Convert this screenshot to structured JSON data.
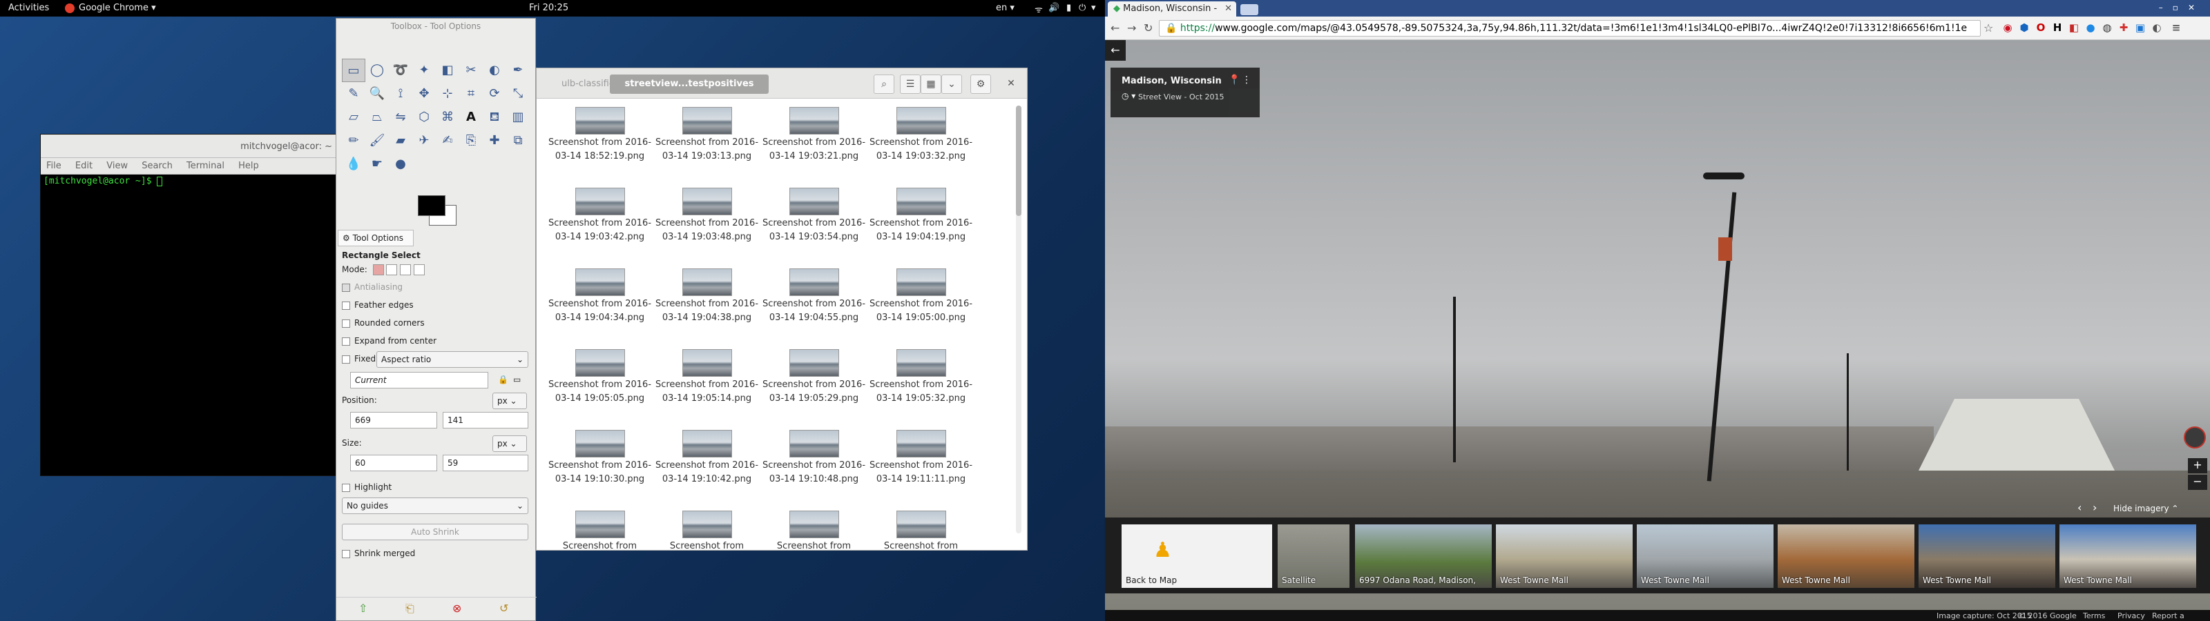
{
  "topbar": {
    "activities": "Activities",
    "app": "Google Chrome ▾",
    "clock": "Fri 20:25",
    "lang": "en ▾"
  },
  "terminal": {
    "title": "mitchvogel@acor: ~",
    "menu": [
      "File",
      "Edit",
      "View",
      "Search",
      "Terminal",
      "Help"
    ],
    "prompt": "[mitchvogel@acor ~]$ "
  },
  "file_manager": {
    "tab_inactive": "ulb-classifier",
    "tab_active": "streetview...testpositives",
    "files": [
      "Screenshot from 2016-03-14 18:52:19.png",
      "Screenshot from 2016-03-14 19:03:13.png",
      "Screenshot from 2016-03-14 19:03:21.png",
      "Screenshot from 2016-03-14 19:03:32.png",
      "Screenshot from 2016-03-14 19:03:42.png",
      "Screenshot from 2016-03-14 19:03:48.png",
      "Screenshot from 2016-03-14 19:03:54.png",
      "Screenshot from 2016-03-14 19:04:19.png",
      "Screenshot from 2016-03-14 19:04:34.png",
      "Screenshot from 2016-03-14 19:04:38.png",
      "Screenshot from 2016-03-14 19:04:55.png",
      "Screenshot from 2016-03-14 19:05:00.png",
      "Screenshot from 2016-03-14 19:05:05.png",
      "Screenshot from 2016-03-14 19:05:14.png",
      "Screenshot from 2016-03-14 19:05:29.png",
      "Screenshot from 2016-03-14 19:05:32.png",
      "Screenshot from 2016-03-14 19:10:30.png",
      "Screenshot from 2016-03-14 19:10:42.png",
      "Screenshot from 2016-03-14 19:10:48.png",
      "Screenshot from 2016-03-14 19:11:11.png",
      "Screenshot from",
      "Screenshot from",
      "Screenshot from",
      "Screenshot from"
    ]
  },
  "gimp": {
    "title": "Toolbox - Tool Options",
    "tool_options_tab": "Tool Options",
    "tool_name": "Rectangle Select",
    "mode_label": "Mode:",
    "antialiasing": "Antialiasing",
    "feather": "Feather edges",
    "rounded": "Rounded corners",
    "expand": "Expand from center",
    "fixed": "Fixed:",
    "fixed_value": "Aspect ratio",
    "current": "Current",
    "position_label": "Position:",
    "pos_x": "669",
    "pos_y": "141",
    "unit": "px",
    "size_label": "Size:",
    "size_w": "60",
    "size_h": "59",
    "highlight": "Highlight",
    "guides": "No guides",
    "auto_shrink": "Auto Shrink",
    "shrink_merged": "Shrink merged"
  },
  "chrome": {
    "tab_title": "Madison, Wisconsin - ",
    "url_https": "https://",
    "url_rest": "www.google.com/maps/@43.0549578,-89.5075324,3a,75y,94.86h,111.32t/data=!3m6!1e1!3m4!1sl34LQ0-ePlBI7o...4iwrZ4Q!2e0!7i13312!8i6656!6m1!1e",
    "ext_h": "H"
  },
  "streetview": {
    "place": "Madison, Wisconsin",
    "date": "Street View - Oct 2015",
    "hide_imagery": "Hide imagery",
    "back_to_map": "Back to Map",
    "satellite": "Satellite",
    "films": [
      "6997 Odana Road, Madison,",
      "West Towne Mall",
      "West Towne Mall",
      "West Towne Mall",
      "West Towne Mall",
      "West Towne Mall"
    ],
    "footer": {
      "capture": "Image capture: Oct 2015",
      "copyright": "© 2016 Google",
      "terms": "Terms",
      "privacy": "Privacy",
      "report": "Report a problem"
    }
  }
}
